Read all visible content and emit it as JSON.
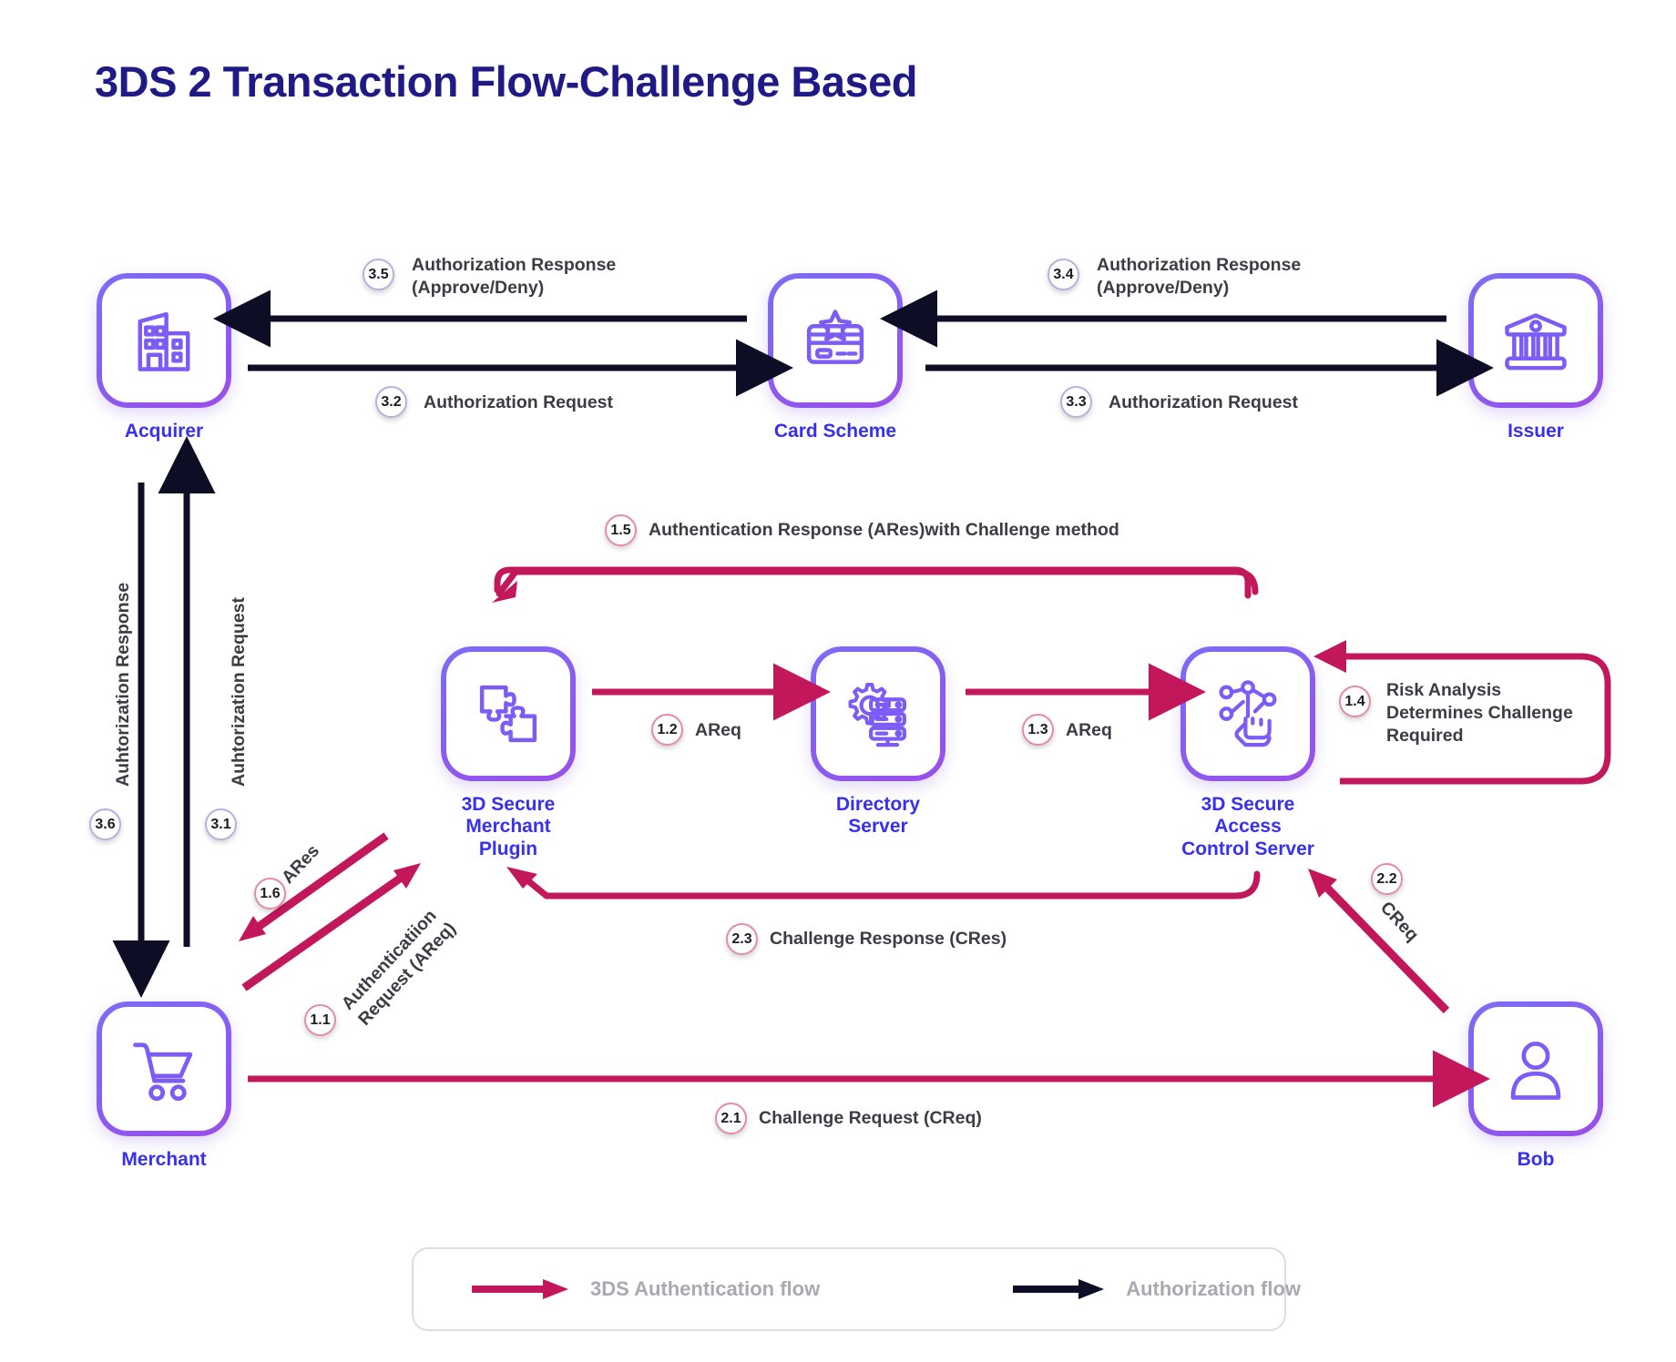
{
  "page": {
    "title": "3DS 2 Transaction Flow-Challenge Based",
    "title_color": "#201a86",
    "background": "#ffffff",
    "auth_flow_color": "#c2185b",
    "authorization_flow_color": "#0d0d26",
    "node_accent_color": "#7c5cf5",
    "node_label_color": "#3730f0"
  },
  "nodes": [
    {
      "id": "acquirer",
      "label": "Acquirer",
      "icon": "office-building-icon"
    },
    {
      "id": "card_scheme",
      "label": "Card Scheme",
      "icon": "credit-card-star-icon"
    },
    {
      "id": "issuer",
      "label": "Issuer",
      "icon": "bank-icon"
    },
    {
      "id": "mpi",
      "label": "3D Secure\nMerchant Plugin",
      "icon": "puzzle-icon"
    },
    {
      "id": "ds",
      "label": "Directory\nServer",
      "icon": "server-gear-icon"
    },
    {
      "id": "acs",
      "label": "3D Secure Access\nControl Server",
      "icon": "network-touch-icon"
    },
    {
      "id": "merchant",
      "label": "Merchant",
      "icon": "shopping-cart-icon"
    },
    {
      "id": "bob",
      "label": "Bob",
      "icon": "user-icon"
    }
  ],
  "edges": [
    {
      "id": "e35",
      "step": "3.5",
      "label": "Authorization Response\n(Approve/Deny)",
      "flow": "authorization"
    },
    {
      "id": "e32",
      "step": "3.2",
      "label": "Authorization Request",
      "flow": "authorization"
    },
    {
      "id": "e34",
      "step": "3.4",
      "label": "Authorization Response\n(Approve/Deny)",
      "flow": "authorization"
    },
    {
      "id": "e33",
      "step": "3.3",
      "label": "Authorization Request",
      "flow": "authorization"
    },
    {
      "id": "e36",
      "step": "3.6",
      "label": "Auhtorization Response",
      "flow": "authorization"
    },
    {
      "id": "e31",
      "step": "3.1",
      "label": "Auhtorization Request",
      "flow": "authorization"
    },
    {
      "id": "e15",
      "step": "1.5",
      "label": "Authentication Response (ARes)with Challenge method",
      "flow": "3ds"
    },
    {
      "id": "e12",
      "step": "1.2",
      "label": "AReq",
      "flow": "3ds"
    },
    {
      "id": "e13",
      "step": "1.3",
      "label": "AReq",
      "flow": "3ds"
    },
    {
      "id": "e14",
      "step": "1.4",
      "label": "Risk Analysis\nDetermines Challenge\nRequired",
      "flow": "3ds"
    },
    {
      "id": "e11",
      "step": "1.1",
      "label": "Authenticatiion\nRequest (AReq)",
      "flow": "3ds"
    },
    {
      "id": "e16",
      "step": "1.6",
      "label": "ARes",
      "flow": "3ds"
    },
    {
      "id": "e21",
      "step": "2.1",
      "label": "Challenge Request (CReq)",
      "flow": "3ds"
    },
    {
      "id": "e22",
      "step": "2.2",
      "label": "CReq",
      "flow": "3ds"
    },
    {
      "id": "e23",
      "step": "2.3",
      "label": "Challenge Response (CRes)",
      "flow": "3ds"
    }
  ],
  "legend": {
    "items": [
      {
        "id": "legend-3ds",
        "label": "3DS Authentication flow",
        "color": "#c2185b"
      },
      {
        "id": "legend-auth",
        "label": "Authorization flow",
        "color": "#0d0d26"
      }
    ]
  }
}
